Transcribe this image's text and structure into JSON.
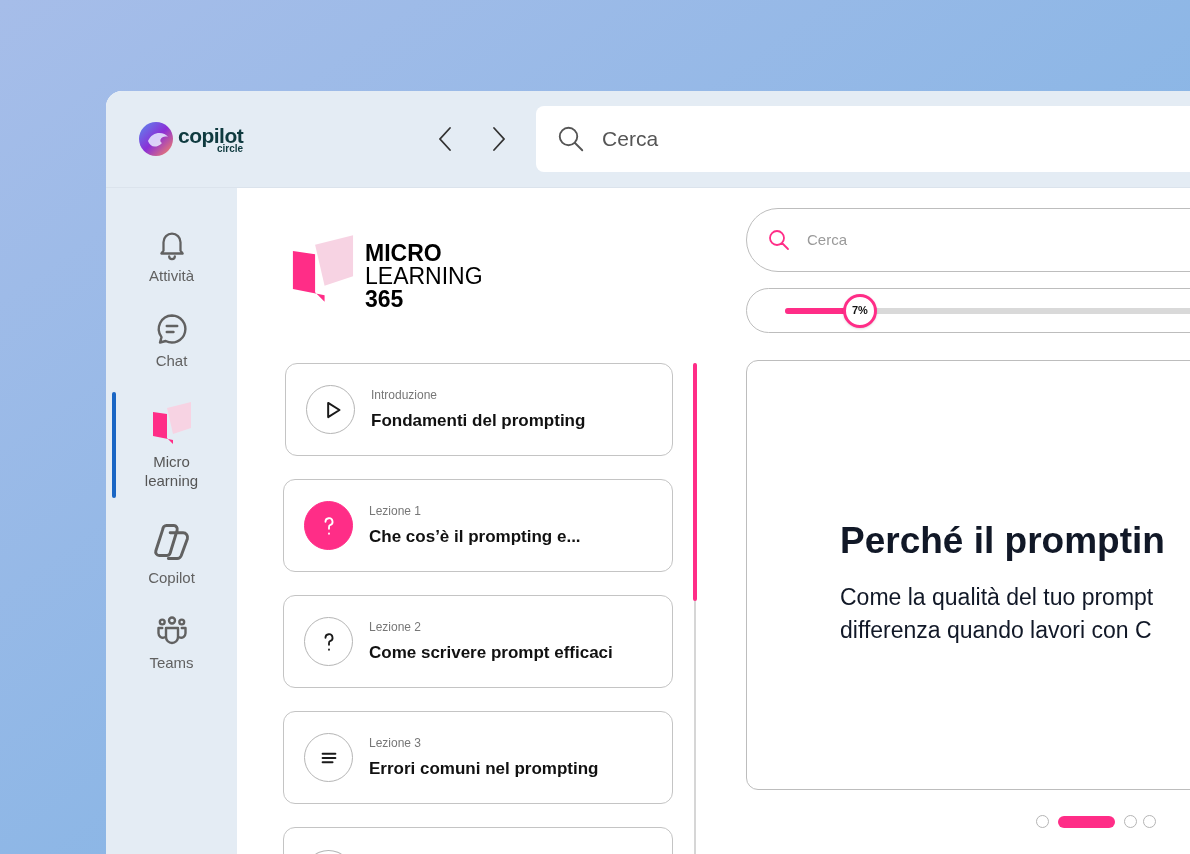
{
  "topbar": {
    "logo": {
      "name": "copilot",
      "tagline": "circle"
    },
    "search": {
      "placeholder": "Cerca"
    }
  },
  "sidebar": {
    "items": [
      {
        "kind": "bell",
        "label": "Attività",
        "selected": false
      },
      {
        "kind": "chat",
        "label": "Chat",
        "selected": false
      },
      {
        "kind": "book",
        "label": "Micro learning",
        "selected": true
      },
      {
        "kind": "copilot",
        "label": "Copilot",
        "selected": false
      },
      {
        "kind": "teams",
        "label": "Teams",
        "selected": false
      }
    ]
  },
  "brand": {
    "line_1": "MICRO",
    "line_2": "LEARNING",
    "line_3": "365"
  },
  "lessons": [
    {
      "kind": "play",
      "label": "Introduzione",
      "title": "Fondamenti del prompting",
      "selected": false
    },
    {
      "kind": "question",
      "label": "Lezione 1",
      "title": "Che cos’è il prompting e...",
      "selected": true
    },
    {
      "kind": "question",
      "label": "Lezione 2",
      "title": "Come scrivere prompt efficaci",
      "selected": false
    },
    {
      "kind": "list",
      "label": "Lezione 3",
      "title": "Errori comuni nel prompting",
      "selected": false
    }
  ],
  "search": {
    "placeholder": "Cerca"
  },
  "progress": {
    "level": 0.07,
    "reading": "7%"
  },
  "slide": {
    "title": "Perché il promptin",
    "lines": [
      "Come la qualità del tuo prompt",
      "differenza quando lavori con C"
    ]
  },
  "pager": [
    {
      "selected": false
    },
    {
      "selected": true
    },
    {
      "selected": false
    },
    {
      "selected": false
    }
  ]
}
